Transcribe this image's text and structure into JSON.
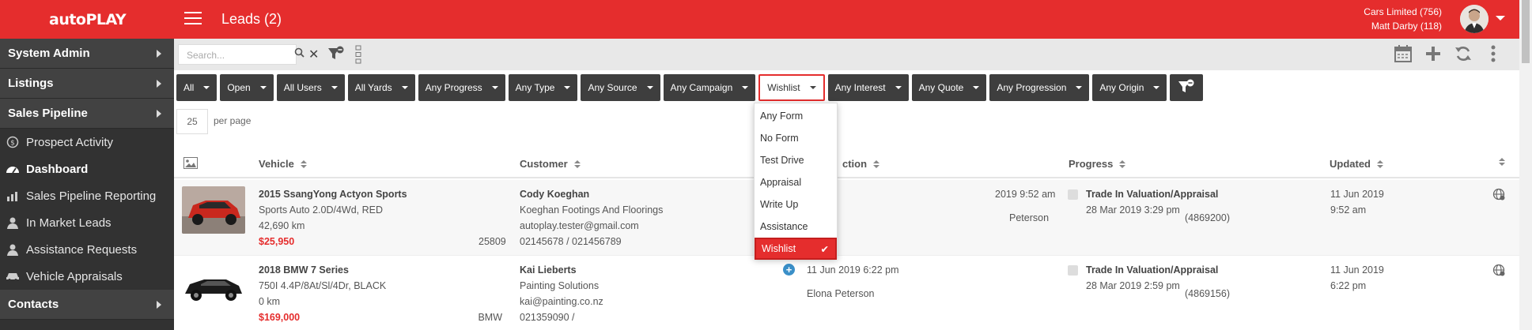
{
  "app": {
    "logo": "autoPLAY",
    "page_title": "Leads (2)",
    "company": "Cars Limited (756)",
    "user": "Matt Darby (118)"
  },
  "sidebar": {
    "sections": [
      {
        "label": "System Admin"
      },
      {
        "label": "Listings"
      },
      {
        "label": "Sales Pipeline"
      }
    ],
    "items": [
      {
        "label": "Prospect Activity",
        "icon": "activity-icon"
      },
      {
        "label": "Dashboard",
        "icon": "dashboard-icon"
      },
      {
        "label": "Sales Pipeline Reporting",
        "icon": "chart-icon"
      },
      {
        "label": "In Market Leads",
        "icon": "user-icon"
      },
      {
        "label": "Assistance Requests",
        "icon": "user-icon"
      },
      {
        "label": "Vehicle Appraisals",
        "icon": "car-icon"
      }
    ],
    "contacts": "Contacts"
  },
  "toolbar": {
    "search_placeholder": "Search..."
  },
  "filters": [
    "All",
    "Open",
    "All Users",
    "All Yards",
    "Any Progress",
    "Any Type",
    "Any Source",
    "Any Campaign",
    "Wishlist",
    "Any Interest",
    "Any Quote",
    "Any Progression",
    "Any Origin"
  ],
  "page_size": "25",
  "per_page_label": "per page",
  "columns": {
    "vehicle": "Vehicle",
    "customer": "Customer",
    "action": "ction",
    "progress": "Progress",
    "updated": "Updated"
  },
  "dropdown": {
    "items": [
      "Any Form",
      "No Form",
      "Test Drive",
      "Appraisal",
      "Write Up",
      "Assistance",
      "Wishlist"
    ],
    "selected": "Wishlist",
    "check": "✔"
  },
  "rows": [
    {
      "vehicle_title": "2015 SsangYong Actyon Sports",
      "vehicle_spec": "Sports Auto 2.0D/4Wd, RED",
      "vehicle_km": "42,690 km",
      "vehicle_price": "$25,950",
      "vehicle_ref": "25809",
      "customer_name": "Cody Koeghan",
      "customer_company": "Koeghan Footings And Floorings",
      "customer_email": "autoplay.tester@gmail.com",
      "customer_phone": "02145678 / 021456789",
      "action_date": "2019 9:52 am",
      "action_user": "Peterson",
      "action_ref": "(4869200)",
      "progress_title": "Trade In Valuation/Appraisal",
      "progress_date": "28 Mar 2019 3:29 pm",
      "updated_date": "11 Jun 2019",
      "updated_time": "9:52 am"
    },
    {
      "vehicle_title": "2018 BMW 7 Series",
      "vehicle_spec": "750I 4.4P/8At/Sl/4Dr, BLACK",
      "vehicle_km": "0 km",
      "vehicle_price": "$169,000",
      "vehicle_ref": "BMW",
      "customer_name": "Kai Lieberts",
      "customer_company": "Painting Solutions",
      "customer_email": "kai@painting.co.nz",
      "customer_phone": "021359090 /",
      "action_date": "11 Jun 2019 6:22 pm",
      "action_user": "Elona Peterson",
      "action_ref": "(4869156)",
      "progress_title": "Trade In Valuation/Appraisal",
      "progress_date": "28 Mar 2019 2:59 pm",
      "updated_date": "11 Jun 2019",
      "updated_time": "6:22 pm"
    }
  ],
  "colors": {
    "brand": "#e52d2d",
    "sidebar": "#323232",
    "filter_button": "#3e3e3e",
    "price": "#e52d2d"
  }
}
